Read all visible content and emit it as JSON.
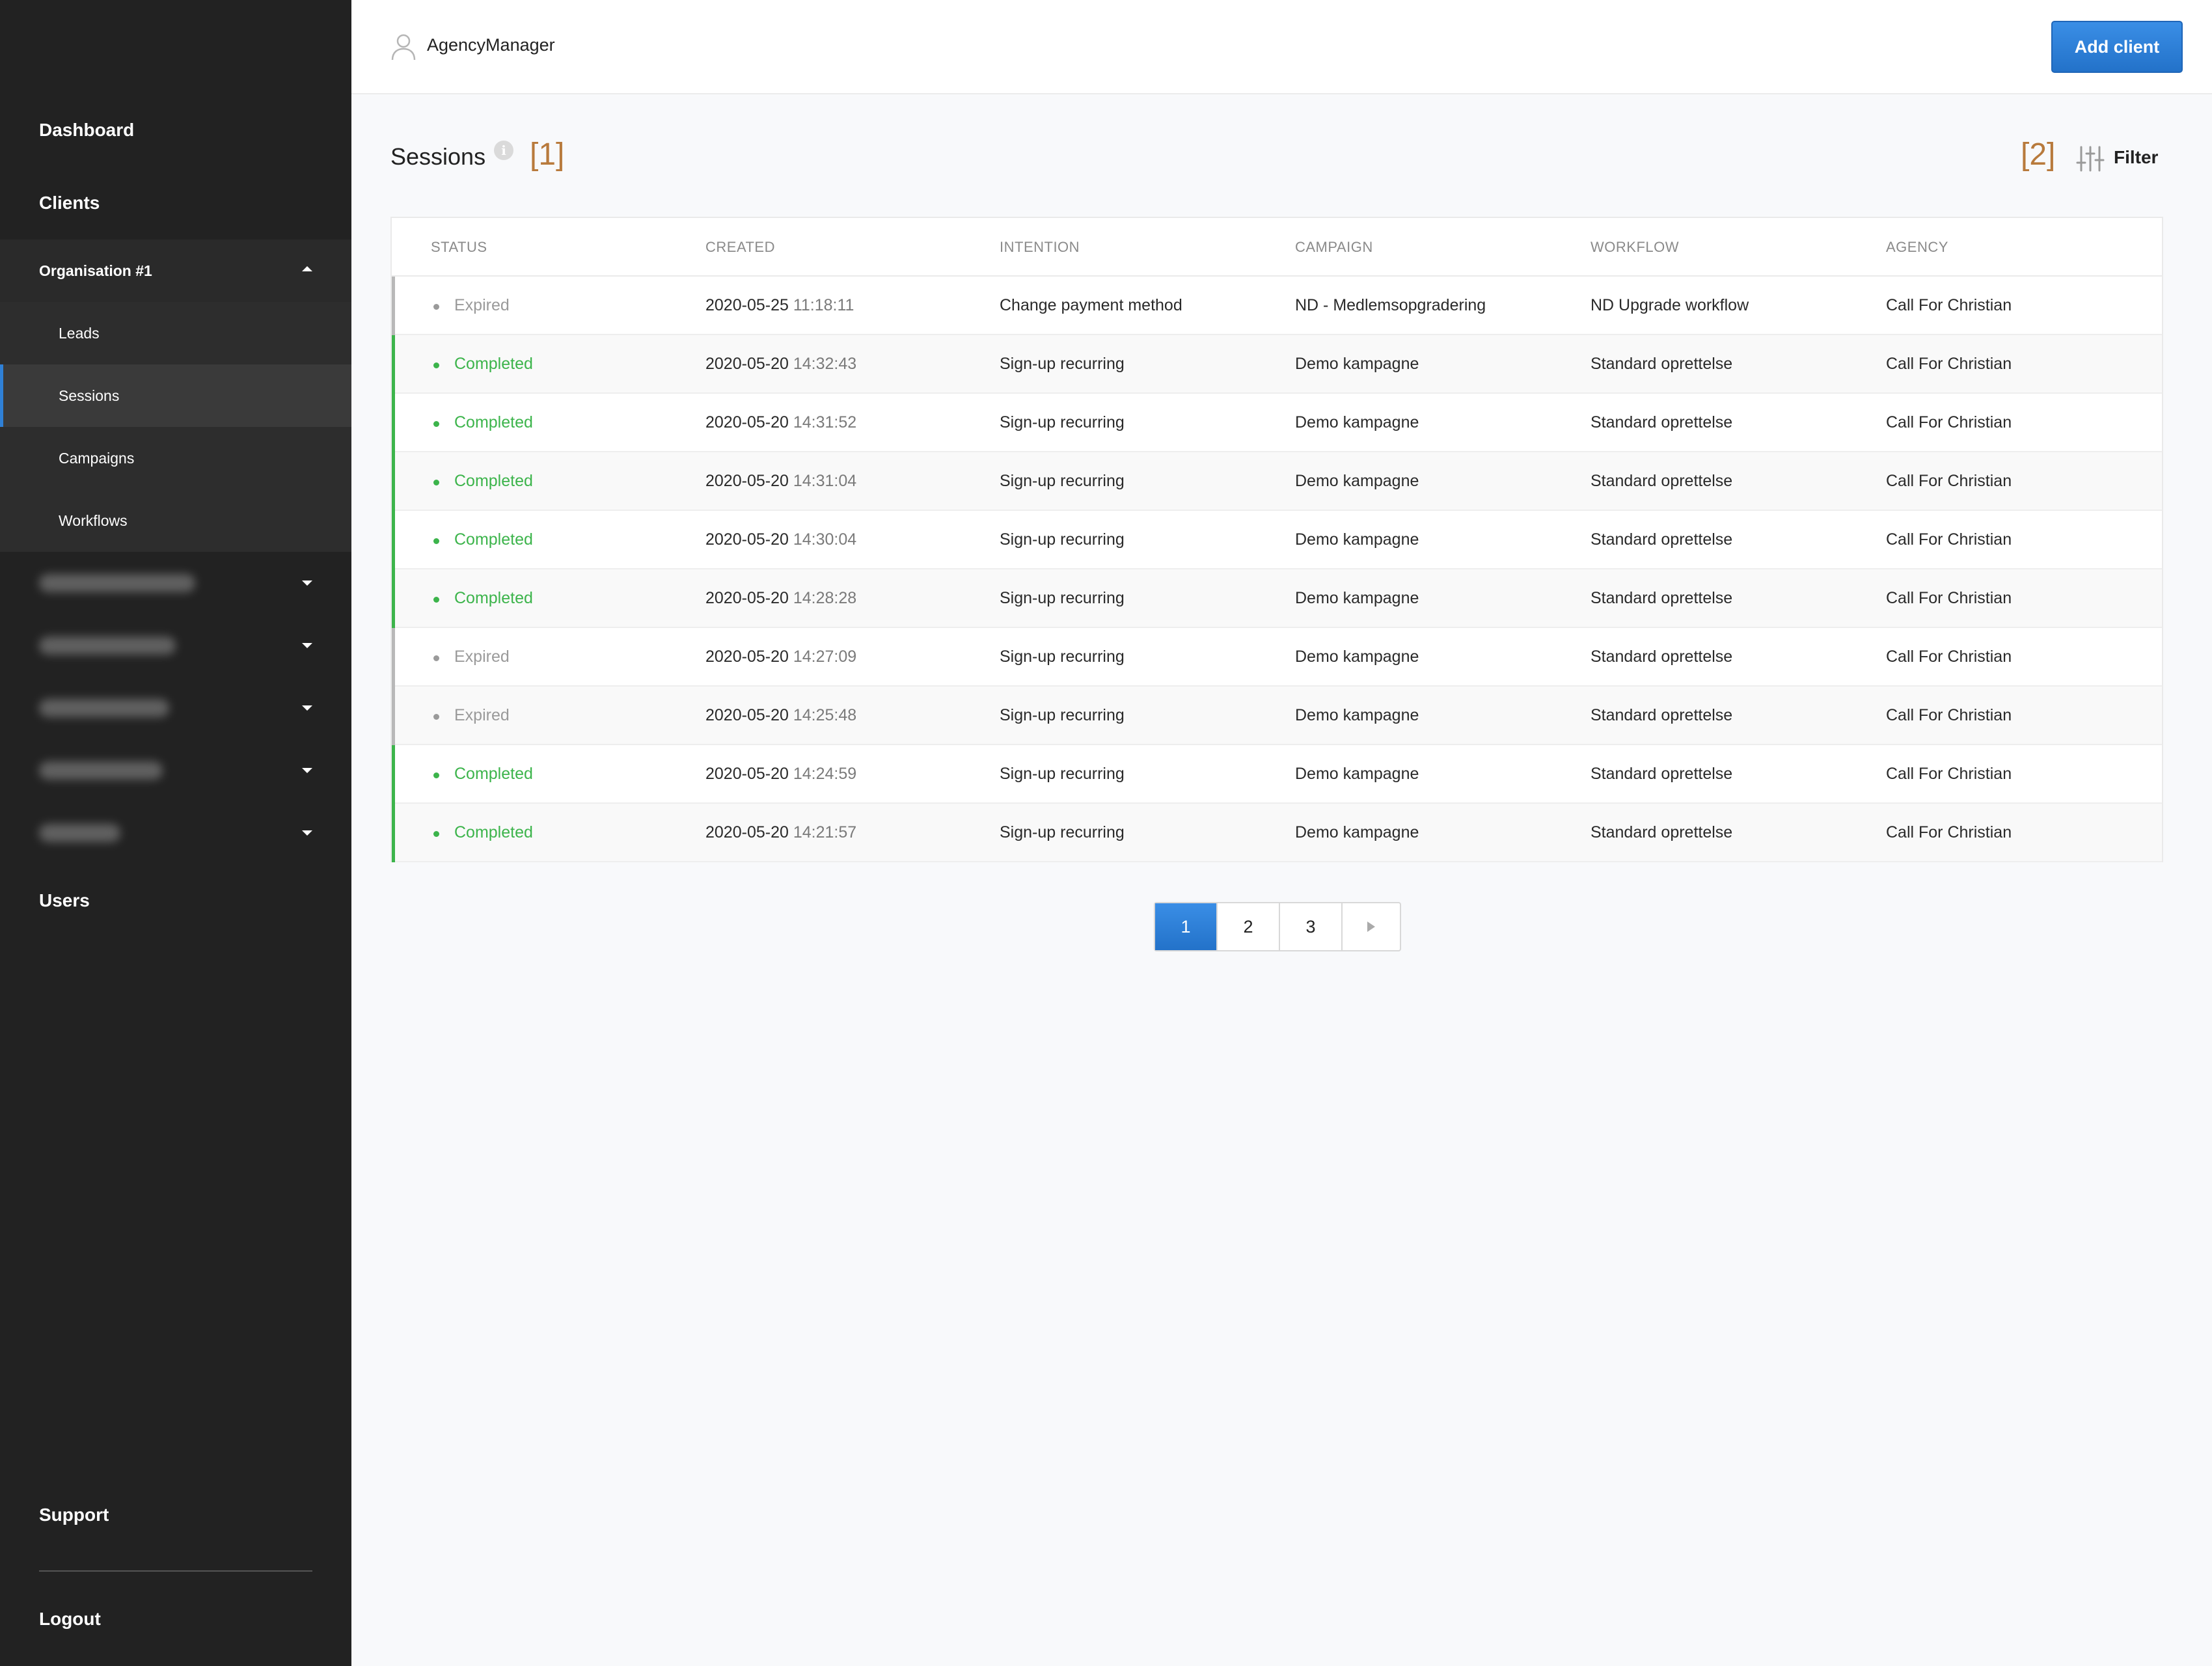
{
  "sidebar": {
    "top_items": [
      {
        "label": "Dashboard"
      },
      {
        "label": "Clients"
      }
    ],
    "organisation": {
      "label": "Organisation #1",
      "items": [
        {
          "label": "Leads"
        },
        {
          "label": "Sessions"
        },
        {
          "label": "Campaigns"
        },
        {
          "label": "Workflows"
        }
      ]
    },
    "users_label": "Users",
    "support_label": "Support",
    "logout_label": "Logout"
  },
  "topbar": {
    "user_name": "AgencyManager",
    "add_client_label": "Add client"
  },
  "page": {
    "title": "Sessions",
    "info_glyph": "i",
    "marker_1": "[1]",
    "marker_2": "[2]",
    "filter_label": "Filter"
  },
  "colors": {
    "completed": "#3cb44b",
    "expired": "#9a9a9a",
    "accent": "#2f80d6",
    "marker": "#b87a3c"
  },
  "table": {
    "columns": [
      "STATUS",
      "CREATED",
      "INTENTION",
      "CAMPAIGN",
      "WORKFLOW",
      "AGENCY"
    ],
    "rows": [
      {
        "status": "Expired",
        "date": "2020-05-25",
        "time": "11:18:11",
        "intention": "Change payment method",
        "campaign": "ND - Medlemsopgradering",
        "workflow": "ND Upgrade workflow",
        "agency": "Call For Christian"
      },
      {
        "status": "Completed",
        "date": "2020-05-20",
        "time": "14:32:43",
        "intention": "Sign-up recurring",
        "campaign": "Demo kampagne",
        "workflow": "Standard oprettelse",
        "agency": "Call For Christian"
      },
      {
        "status": "Completed",
        "date": "2020-05-20",
        "time": "14:31:52",
        "intention": "Sign-up recurring",
        "campaign": "Demo kampagne",
        "workflow": "Standard oprettelse",
        "agency": "Call For Christian"
      },
      {
        "status": "Completed",
        "date": "2020-05-20",
        "time": "14:31:04",
        "intention": "Sign-up recurring",
        "campaign": "Demo kampagne",
        "workflow": "Standard oprettelse",
        "agency": "Call For Christian"
      },
      {
        "status": "Completed",
        "date": "2020-05-20",
        "time": "14:30:04",
        "intention": "Sign-up recurring",
        "campaign": "Demo kampagne",
        "workflow": "Standard oprettelse",
        "agency": "Call For Christian"
      },
      {
        "status": "Completed",
        "date": "2020-05-20",
        "time": "14:28:28",
        "intention": "Sign-up recurring",
        "campaign": "Demo kampagne",
        "workflow": "Standard oprettelse",
        "agency": "Call For Christian"
      },
      {
        "status": "Expired",
        "date": "2020-05-20",
        "time": "14:27:09",
        "intention": "Sign-up recurring",
        "campaign": "Demo kampagne",
        "workflow": "Standard oprettelse",
        "agency": "Call For Christian"
      },
      {
        "status": "Expired",
        "date": "2020-05-20",
        "time": "14:25:48",
        "intention": "Sign-up recurring",
        "campaign": "Demo kampagne",
        "workflow": "Standard oprettelse",
        "agency": "Call For Christian"
      },
      {
        "status": "Completed",
        "date": "2020-05-20",
        "time": "14:24:59",
        "intention": "Sign-up recurring",
        "campaign": "Demo kampagne",
        "workflow": "Standard oprettelse",
        "agency": "Call For Christian"
      },
      {
        "status": "Completed",
        "date": "2020-05-20",
        "time": "14:21:57",
        "intention": "Sign-up recurring",
        "campaign": "Demo kampagne",
        "workflow": "Standard oprettelse",
        "agency": "Call For Christian"
      }
    ]
  },
  "pagination": {
    "pages": [
      "1",
      "2",
      "3"
    ],
    "current": "1"
  }
}
